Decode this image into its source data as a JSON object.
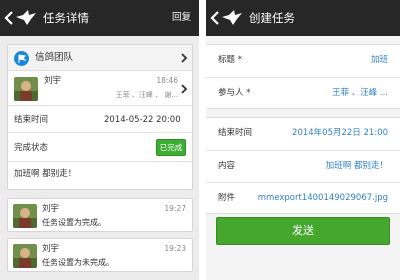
{
  "left": {
    "header": {
      "title": "任务详情",
      "action": "回复"
    },
    "team": {
      "name": "信鸽团队"
    },
    "owner": {
      "name": "刘宇",
      "time": "18:46",
      "participants": "王菲 、汪峰 、 谢..."
    },
    "end_time": {
      "label": "结束时间",
      "value": "2014-05-22 20:00"
    },
    "status": {
      "label": "完成状态",
      "button": "已完成"
    },
    "content": "加班啊 都别走！",
    "comments": [
      {
        "name": "刘宇",
        "time": "19:27",
        "text": "任务设置为完成。"
      },
      {
        "name": "刘宇",
        "time": "19:23",
        "text": "任务设置为未完成。"
      }
    ]
  },
  "right": {
    "header": {
      "title": "创建任务"
    },
    "fields": [
      {
        "label": "标题 *",
        "value": "加班"
      },
      {
        "label": "参与人 *",
        "value": "王菲 、汪峰 ..."
      },
      {
        "label": "结束时间",
        "value": "2014年05月22日 21:00"
      },
      {
        "label": "内容",
        "value": "加班啊 都别走！"
      },
      {
        "label": "附件",
        "value": "mmexport1400149029067.jpg"
      }
    ],
    "send_label": "发送"
  },
  "colors": {
    "topbar": "#272727",
    "accent_green": "#45a72e",
    "link_blue": "#2f7fc4",
    "flag_blue": "#1a88d8"
  },
  "icons": {
    "back": "chevron-left-icon",
    "logo": "pigeon-logo-icon",
    "team": "flag-icon",
    "avatar": "avatar-photo"
  }
}
